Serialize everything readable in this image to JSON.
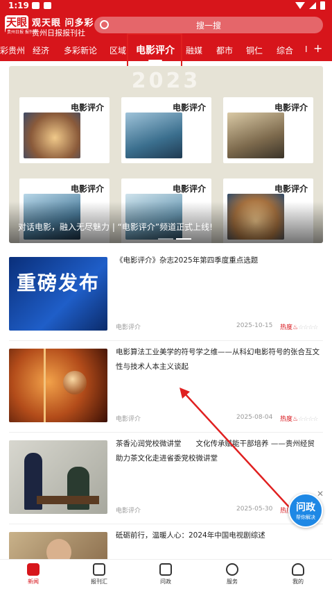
{
  "status": {
    "time": "1:19"
  },
  "header": {
    "logo": "天眼",
    "logo_sub": "贵州日报 报刊社",
    "brand_line1": "观天眼 问多彩",
    "brand_line2": "贵州日报报刊社",
    "search_placeholder": "搜一搜"
  },
  "tabs": [
    {
      "label": "多彩贵州"
    },
    {
      "label": "经济"
    },
    {
      "label": "多彩新论"
    },
    {
      "label": "区域"
    },
    {
      "label": "电影评介",
      "active": true
    },
    {
      "label": "融媒"
    },
    {
      "label": "都市"
    },
    {
      "label": "铜仁"
    },
    {
      "label": "综合"
    },
    {
      "label": "I"
    }
  ],
  "tab_more_icon": "plus-icon",
  "banner": {
    "year": "2023",
    "mag_title": "电影评介",
    "caption": "对话电影，融入无尽魅力 | “电影评介”频道正式上线!"
  },
  "news": [
    {
      "title": "《电影评介》杂志2025年第四季度重点选题",
      "thumb_text": "重磅发布",
      "source": "电影评介",
      "date": "2025-10-15",
      "hot": "热度"
    },
    {
      "title": "电影算法工业美学的符号学之维——从科幻电影符号的张合互文性与技术人本主义谈起",
      "source": "电影评介",
      "date": "2025-08-04",
      "hot": "热度"
    },
    {
      "title": "茶香沁润党校微讲堂　　文化传承赋能干部培养 ——贵州经贸助力茶文化走进省委党校微讲堂",
      "source": "电影评介",
      "date": "2025-05-30",
      "hot": "热度"
    },
    {
      "title": "砥砺前行，温暖人心：2024年中国电视剧综述"
    }
  ],
  "fab": {
    "main": "问政",
    "sub": "帮你解决"
  },
  "bottom_nav": [
    {
      "label": "新闻",
      "active": true
    },
    {
      "label": "报刊汇"
    },
    {
      "label": "问政"
    },
    {
      "label": "服务"
    },
    {
      "label": "我的"
    }
  ],
  "colors": {
    "brand_red": "#d7151b",
    "fab_blue": "#1e88e5"
  }
}
